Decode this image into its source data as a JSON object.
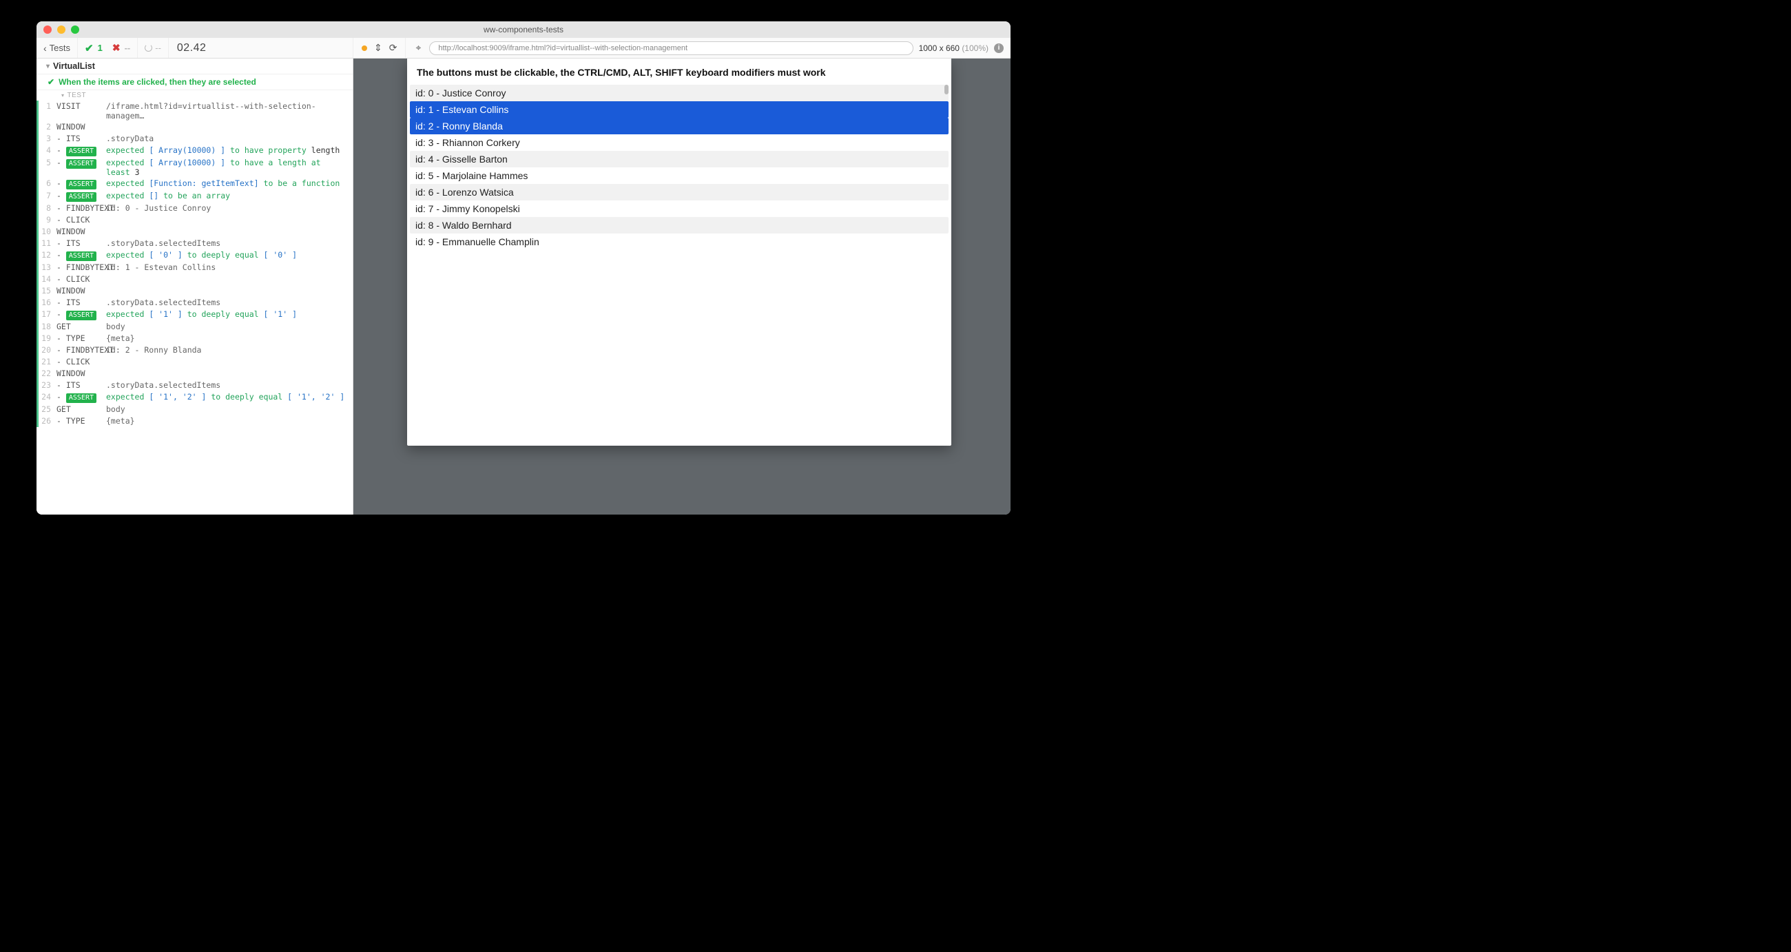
{
  "window": {
    "title": "ww-components-tests"
  },
  "header": {
    "back_label": "Tests",
    "pass_count": "1",
    "fail_count": "--",
    "spinner_label": "--",
    "timer": "02.42",
    "url": "http://localhost:9009/iframe.html?id=virtuallist--with-selection-management",
    "dims": "1000 x 660",
    "pct": "(100%)"
  },
  "suite": {
    "name": "VirtualList",
    "test_name": "When the items are clicked, then they are selected",
    "body_label": "TEST"
  },
  "steps": [
    {
      "n": "1",
      "cmd": "VISIT",
      "args_html": "/iframe.html?id=virtuallist--with-selection-managem…"
    },
    {
      "n": "2",
      "cmd": "WINDOW",
      "args_html": ""
    },
    {
      "n": "3",
      "cmd": "- ITS",
      "args_html": ".storyData"
    },
    {
      "n": "4",
      "cmd": "- ASSERT",
      "assert": true,
      "args_html": "<span class='kw-green'>expected</span> <span class='kw-blue'>[ Array(10000) ]</span> <span class='kw-green'>to have property</span> <span class='kw-black'>length</span>"
    },
    {
      "n": "5",
      "cmd": "- ASSERT",
      "assert": true,
      "args_html": "<span class='kw-green'>expected</span> <span class='kw-blue'>[ Array(10000) ]</span> <span class='kw-green'>to have a length at least</span> <span class='kw-black'>3</span>"
    },
    {
      "n": "6",
      "cmd": "- ASSERT",
      "assert": true,
      "args_html": "<span class='kw-green'>expected</span> <span class='kw-blue'>[Function: getItemText]</span> <span class='kw-green'>to be a function</span>"
    },
    {
      "n": "7",
      "cmd": "- ASSERT",
      "assert": true,
      "args_html": "<span class='kw-green'>expected</span> <span class='kw-blue'>[]</span> <span class='kw-green'>to be an array</span>"
    },
    {
      "n": "8",
      "cmd": "- FINDBYTEXT",
      "args_html": "id: 0 - Justice Conroy"
    },
    {
      "n": "9",
      "cmd": "- CLICK",
      "args_html": ""
    },
    {
      "n": "10",
      "cmd": "WINDOW",
      "args_html": ""
    },
    {
      "n": "11",
      "cmd": "- ITS",
      "args_html": ".storyData.selectedItems"
    },
    {
      "n": "12",
      "cmd": "- ASSERT",
      "assert": true,
      "args_html": "<span class='kw-green'>expected</span> <span class='kw-blue'>[ '0' ]</span> <span class='kw-green'>to deeply equal</span> <span class='kw-blue'>[ '0' ]</span>"
    },
    {
      "n": "13",
      "cmd": "- FINDBYTEXT",
      "args_html": "id: 1 - Estevan Collins"
    },
    {
      "n": "14",
      "cmd": "- CLICK",
      "args_html": ""
    },
    {
      "n": "15",
      "cmd": "WINDOW",
      "args_html": ""
    },
    {
      "n": "16",
      "cmd": "- ITS",
      "args_html": ".storyData.selectedItems"
    },
    {
      "n": "17",
      "cmd": "- ASSERT",
      "assert": true,
      "args_html": "<span class='kw-green'>expected</span> <span class='kw-blue'>[ '1' ]</span> <span class='kw-green'>to deeply equal</span> <span class='kw-blue'>[ '1' ]</span>"
    },
    {
      "n": "18",
      "cmd": "GET",
      "args_html": "body"
    },
    {
      "n": "19",
      "cmd": "- TYPE",
      "args_html": "{meta}"
    },
    {
      "n": "20",
      "cmd": "- FINDBYTEXT",
      "args_html": "id: 2 - Ronny Blanda"
    },
    {
      "n": "21",
      "cmd": "- CLICK",
      "args_html": ""
    },
    {
      "n": "22",
      "cmd": "WINDOW",
      "args_html": ""
    },
    {
      "n": "23",
      "cmd": "- ITS",
      "args_html": ".storyData.selectedItems"
    },
    {
      "n": "24",
      "cmd": "- ASSERT",
      "assert": true,
      "args_html": "<span class='kw-green'>expected</span> <span class='kw-blue'>[ '1', '2' ]</span> <span class='kw-green'>to deeply equal</span> <span class='kw-blue'>[ '1', '2' ]</span>"
    },
    {
      "n": "25",
      "cmd": "GET",
      "args_html": "body"
    },
    {
      "n": "26",
      "cmd": "- TYPE",
      "args_html": "{meta}"
    }
  ],
  "preview": {
    "banner": "The buttons must be clickable, the CTRL/CMD, ALT, SHIFT keyboard modifiers must work",
    "items": [
      {
        "text": "id: 0 - Justice Conroy",
        "selected": false
      },
      {
        "text": "id: 1 - Estevan Collins",
        "selected": true
      },
      {
        "text": "id: 2 - Ronny Blanda",
        "selected": true
      },
      {
        "text": "id: 3 - Rhiannon Corkery",
        "selected": false
      },
      {
        "text": "id: 4 - Gisselle Barton",
        "selected": false
      },
      {
        "text": "id: 5 - Marjolaine Hammes",
        "selected": false
      },
      {
        "text": "id: 6 - Lorenzo Watsica",
        "selected": false
      },
      {
        "text": "id: 7 - Jimmy Konopelski",
        "selected": false
      },
      {
        "text": "id: 8 - Waldo Bernhard",
        "selected": false
      },
      {
        "text": "id: 9 - Emmanuelle Champlin",
        "selected": false
      }
    ]
  }
}
